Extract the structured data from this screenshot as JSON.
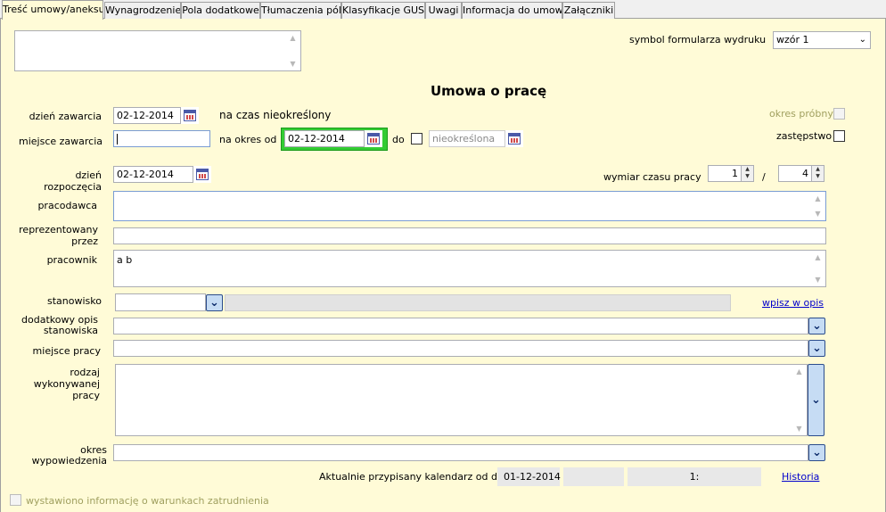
{
  "tabs": [
    "Treść umowy/aneksu",
    "Wynagrodzenie",
    "Pola dodatkowe",
    "Tłumaczenia pól",
    "Klasyfikacje GUS",
    "Uwagi",
    "Informacja do umowy",
    "Załączniki"
  ],
  "print_form": {
    "label": "symbol formularza wydruku",
    "value": "wzór 1"
  },
  "title": "Umowa o pracę",
  "dzien_zawarcia": {
    "label": "dzień zawarcia",
    "value": "02-12-2014"
  },
  "czas_nieokreslony": "na czas nieokreślony",
  "miejsce_zawarcia": {
    "label": "miejsce zawarcia",
    "value": ""
  },
  "okres_od": {
    "label": "na okres od",
    "value": "02-12-2014"
  },
  "do": {
    "label": "do",
    "placeholder": "nieokreślona"
  },
  "okres_probny": "okres próbny",
  "zastepstwo": "zastępstwo",
  "dzien_rozpoczecia": {
    "label_1": "dzień",
    "label_2": "rozpoczęcia",
    "value": "02-12-2014"
  },
  "wymiar": {
    "label": "wymiar czasu pracy",
    "num": "1",
    "sep": "/",
    "den": "4"
  },
  "pracodawca": {
    "label": "pracodawca",
    "value": ""
  },
  "reprezentowany": {
    "label_1": "reprezentowany",
    "label_2": "przez",
    "value": ""
  },
  "pracownik": {
    "label": "pracownik",
    "value": "a b"
  },
  "stanowisko": {
    "label": "stanowisko",
    "value": "",
    "link": "wpisz w opis"
  },
  "dodatkowy_opis": {
    "label_1": "dodatkowy opis",
    "label_2": "stanowiska",
    "value": ""
  },
  "miejsce_pracy": {
    "label": "miejsce  pracy",
    "value": ""
  },
  "rodzaj": {
    "label_1": "rodzaj",
    "label_2": "wykonywanej",
    "label_3": "pracy",
    "value": ""
  },
  "okres_wypowiedzenia": {
    "label_1": "okres",
    "label_2": "wypowiedzenia",
    "value": ""
  },
  "kalendarz": {
    "label": "Aktualnie przypisany kalendarz od dnia",
    "date": "01-12-2014",
    "field2": "",
    "field3": "1:",
    "link": "Historia"
  },
  "wystawiono": "wystawiono informację o warunkach zatrudnienia",
  "icons": {
    "calendar": "calendar-icon",
    "dropdown": "chevron-down-icon"
  }
}
